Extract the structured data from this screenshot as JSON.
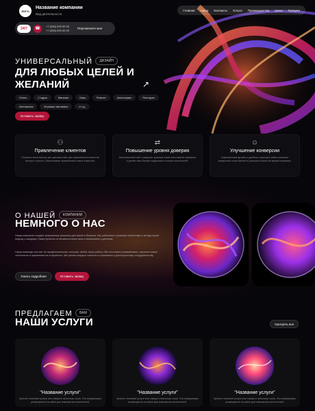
{
  "header": {
    "logo_text": "ЛОГО",
    "company_name": "Название компании",
    "activity": "Вид деятельности",
    "nav": [
      "Главная",
      "Наша",
      "Контакты",
      "Услуги",
      "Преимущества",
      "Цены",
      "Галерея"
    ]
  },
  "contact": {
    "badge": "24/7",
    "phone1": "+7 (000) 000 00 00",
    "phone2": "+7 (000) 000 00 00",
    "callback": "Перезвоните мне"
  },
  "hero": {
    "line1": "УНИВЕРСАЛЬНЫЙ",
    "tag": "ДИЗАЙН",
    "title": "ДЛЯ ЛЮБЫХ ЦЕЛЕЙ И ЖЕЛАНИЙ",
    "arrow": "↗",
    "chips": [
      "Отель",
      "Студия",
      "Магазин",
      "Банк",
      "Ремонт",
      "Автосервис",
      "Ресторан",
      "Автошкола",
      "Игровые автоматы",
      "и т.д."
    ],
    "cta": "Оставить заявку"
  },
  "features": [
    {
      "icon": "people-icon",
      "title": "Привлечение клиентов",
      "desc": "Показать всем быстро мы сделаем сайт для привлечения клиентов быстро и просто, обеспечивая привлечение новых клиентов."
    },
    {
      "icon": "handshake-icon",
      "title": "Повышение уровня доверия",
      "desc": "Качественный сайт повышает доверие клиентов к вашей компании и делает ваш бизнес надежным в глазах посетителей."
    },
    {
      "icon": "person-icon",
      "title": "Улучшение конверсии",
      "desc": "Современный дизайн и удобная структура сайта помогают превратить посетителей в реальных клиентов вашей компании."
    }
  ],
  "about": {
    "line1": "О НАШЕЙ",
    "tag": "КОМПАНИИ",
    "title": "НЕМНОГО О НАС",
    "para1": "Наша компания создает уникальные решения для вашего бизнеса. Мы работаем с разными клиентами и всегда ищем подход к каждому. Наши проекты отличаются качеством и вниманием к деталям.",
    "para2": "Наша команда состоит из профессионалов, которые любят свою работу. Мы постоянно развиваемся, изучаем новые технологии и применяем их в проектах. Мы ценим каждого клиента и стремимся к долгосрочному сотрудничеству.",
    "btn_more": "Узнать подробнее",
    "btn_cta": "Оставить заявку"
  },
  "services": {
    "line1": "ПРЕДЛАГАЕМ",
    "tag": "ВАМ",
    "title": "НАШИ УСЛУГИ",
    "view_all": "Смотреть все",
    "items": [
      {
        "title": "\"Название услуги\"",
        "desc": "Краткое описание услуги или товара в несколько строк. Эта информация размещается на сайте для знакомства посетителей."
      },
      {
        "title": "\"Название услуги\"",
        "desc": "Краткое описание услуги или товара в несколько строк. Эта информация размещается на сайте для знакомства посетителей."
      },
      {
        "title": "\"Название услуги\"",
        "desc": "Краткое описание услуги или товара в несколько строк. Эта информация размещается на сайте для знакомства посетителей."
      }
    ]
  },
  "colors": {
    "accent": "#b3143a",
    "background": "#07060a"
  }
}
